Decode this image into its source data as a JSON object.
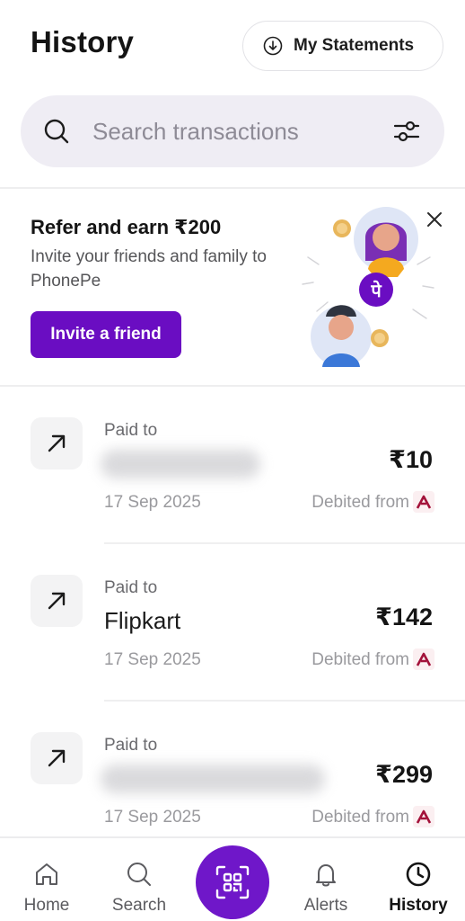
{
  "header": {
    "title": "History",
    "statements_label": "My Statements"
  },
  "search": {
    "placeholder": "Search transactions"
  },
  "refer": {
    "title": "Refer and earn ₹200",
    "subtitle": "Invite your friends and family to PhonePe",
    "button_label": "Invite a friend",
    "badge_glyph": "पे"
  },
  "transactions": [
    {
      "label": "Paid to",
      "name": "",
      "name_hidden": true,
      "amount": "₹10",
      "date": "17 Sep 2025",
      "debit": "Debited from"
    },
    {
      "label": "Paid to",
      "name": "Flipkart",
      "name_hidden": false,
      "amount": "₹142",
      "date": "17 Sep 2025",
      "debit": "Debited from"
    },
    {
      "label": "Paid to",
      "name": "",
      "name_hidden": true,
      "amount": "₹299",
      "date": "17 Sep 2025",
      "debit": "Debited from"
    }
  ],
  "nav": {
    "items": [
      {
        "label": "Home",
        "icon": "home-icon"
      },
      {
        "label": "Search",
        "icon": "search-icon"
      },
      {
        "label": "",
        "icon": "qr-scan-icon"
      },
      {
        "label": "Alerts",
        "icon": "bell-icon"
      },
      {
        "label": "History",
        "icon": "clock-icon",
        "active": true
      }
    ]
  },
  "colors": {
    "brand_purple": "#6a0dc2",
    "search_bg": "#efedf4",
    "bank_red": "#a3123a"
  }
}
